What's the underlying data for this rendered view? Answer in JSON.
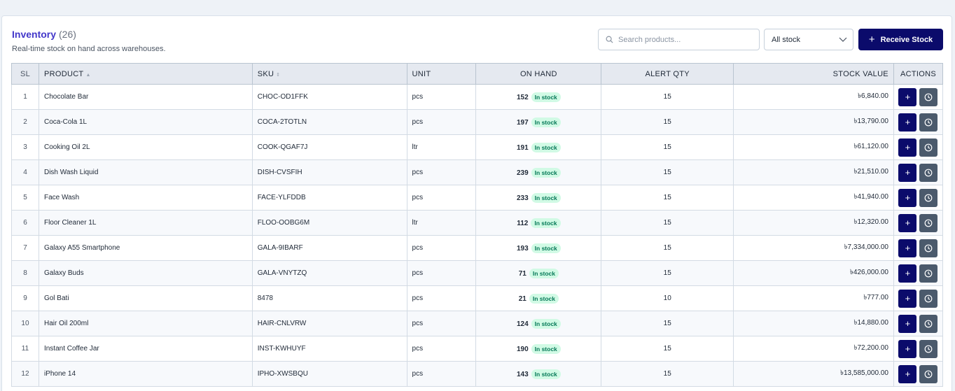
{
  "header": {
    "title": "Inventory",
    "count": "(26)",
    "subtitle": "Real-time stock on hand across warehouses."
  },
  "toolbar": {
    "search_placeholder": "Search products...",
    "filter_value": "All stock",
    "receive_label": "Receive Stock"
  },
  "table": {
    "columns": [
      "SL",
      "PRODUCT",
      "SKU",
      "UNIT",
      "ON HAND",
      "ALERT QTY",
      "STOCK VALUE",
      "ACTIONS"
    ],
    "rows": [
      {
        "sl": "1",
        "product": "Chocolate Bar",
        "sku": "CHOC-OD1FFK",
        "unit": "pcs",
        "on_hand": "152",
        "status": "In stock",
        "alert": "15",
        "value": "৳6,840.00"
      },
      {
        "sl": "2",
        "product": "Coca-Cola 1L",
        "sku": "COCA-2TOTLN",
        "unit": "pcs",
        "on_hand": "197",
        "status": "In stock",
        "alert": "15",
        "value": "৳13,790.00"
      },
      {
        "sl": "3",
        "product": "Cooking Oil 2L",
        "sku": "COOK-QGAF7J",
        "unit": "ltr",
        "on_hand": "191",
        "status": "In stock",
        "alert": "15",
        "value": "৳61,120.00"
      },
      {
        "sl": "4",
        "product": "Dish Wash Liquid",
        "sku": "DISH-CVSFIH",
        "unit": "pcs",
        "on_hand": "239",
        "status": "In stock",
        "alert": "15",
        "value": "৳21,510.00"
      },
      {
        "sl": "5",
        "product": "Face Wash",
        "sku": "FACE-YLFDDB",
        "unit": "pcs",
        "on_hand": "233",
        "status": "In stock",
        "alert": "15",
        "value": "৳41,940.00"
      },
      {
        "sl": "6",
        "product": "Floor Cleaner 1L",
        "sku": "FLOO-OOBG6M",
        "unit": "ltr",
        "on_hand": "112",
        "status": "In stock",
        "alert": "15",
        "value": "৳12,320.00"
      },
      {
        "sl": "7",
        "product": "Galaxy A55 Smartphone",
        "sku": "GALA-9IBARF",
        "unit": "pcs",
        "on_hand": "193",
        "status": "In stock",
        "alert": "15",
        "value": "৳7,334,000.00"
      },
      {
        "sl": "8",
        "product": "Galaxy Buds",
        "sku": "GALA-VNYTZQ",
        "unit": "pcs",
        "on_hand": "71",
        "status": "In stock",
        "alert": "15",
        "value": "৳426,000.00"
      },
      {
        "sl": "9",
        "product": "Gol Bati",
        "sku": "8478",
        "unit": "pcs",
        "on_hand": "21",
        "status": "In stock",
        "alert": "10",
        "value": "৳777.00"
      },
      {
        "sl": "10",
        "product": "Hair Oil 200ml",
        "sku": "HAIR-CNLVRW",
        "unit": "pcs",
        "on_hand": "124",
        "status": "In stock",
        "alert": "15",
        "value": "৳14,880.00"
      },
      {
        "sl": "11",
        "product": "Instant Coffee Jar",
        "sku": "INST-KWHUYF",
        "unit": "pcs",
        "on_hand": "190",
        "status": "In stock",
        "alert": "15",
        "value": "৳72,200.00"
      },
      {
        "sl": "12",
        "product": "iPhone 14",
        "sku": "IPHO-XWSBQU",
        "unit": "pcs",
        "on_hand": "143",
        "status": "In stock",
        "alert": "15",
        "value": "৳13,585,000.00"
      }
    ]
  }
}
